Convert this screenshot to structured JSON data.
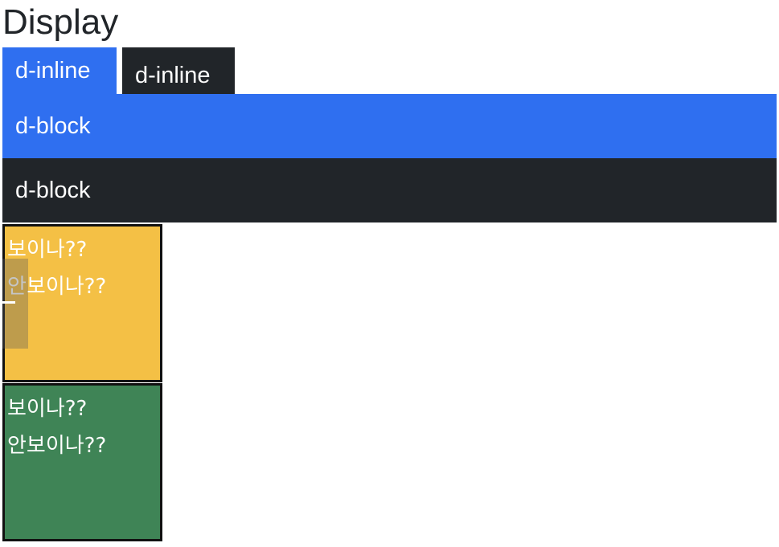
{
  "title": "Display",
  "inline_items": [
    {
      "label": "d-inline",
      "color": "#2f6ff0"
    },
    {
      "label": "d-inline",
      "color": "#212529"
    }
  ],
  "block_items": [
    {
      "label": "d-block",
      "color": "#2f6ff0"
    },
    {
      "label": "d-block",
      "color": "#212529"
    }
  ],
  "visibility_boxes": [
    {
      "text": "보이나?? 안보이나??",
      "color": "#f4c045"
    },
    {
      "text": "보이나?? 안보이나??",
      "color": "#3f8456"
    }
  ]
}
